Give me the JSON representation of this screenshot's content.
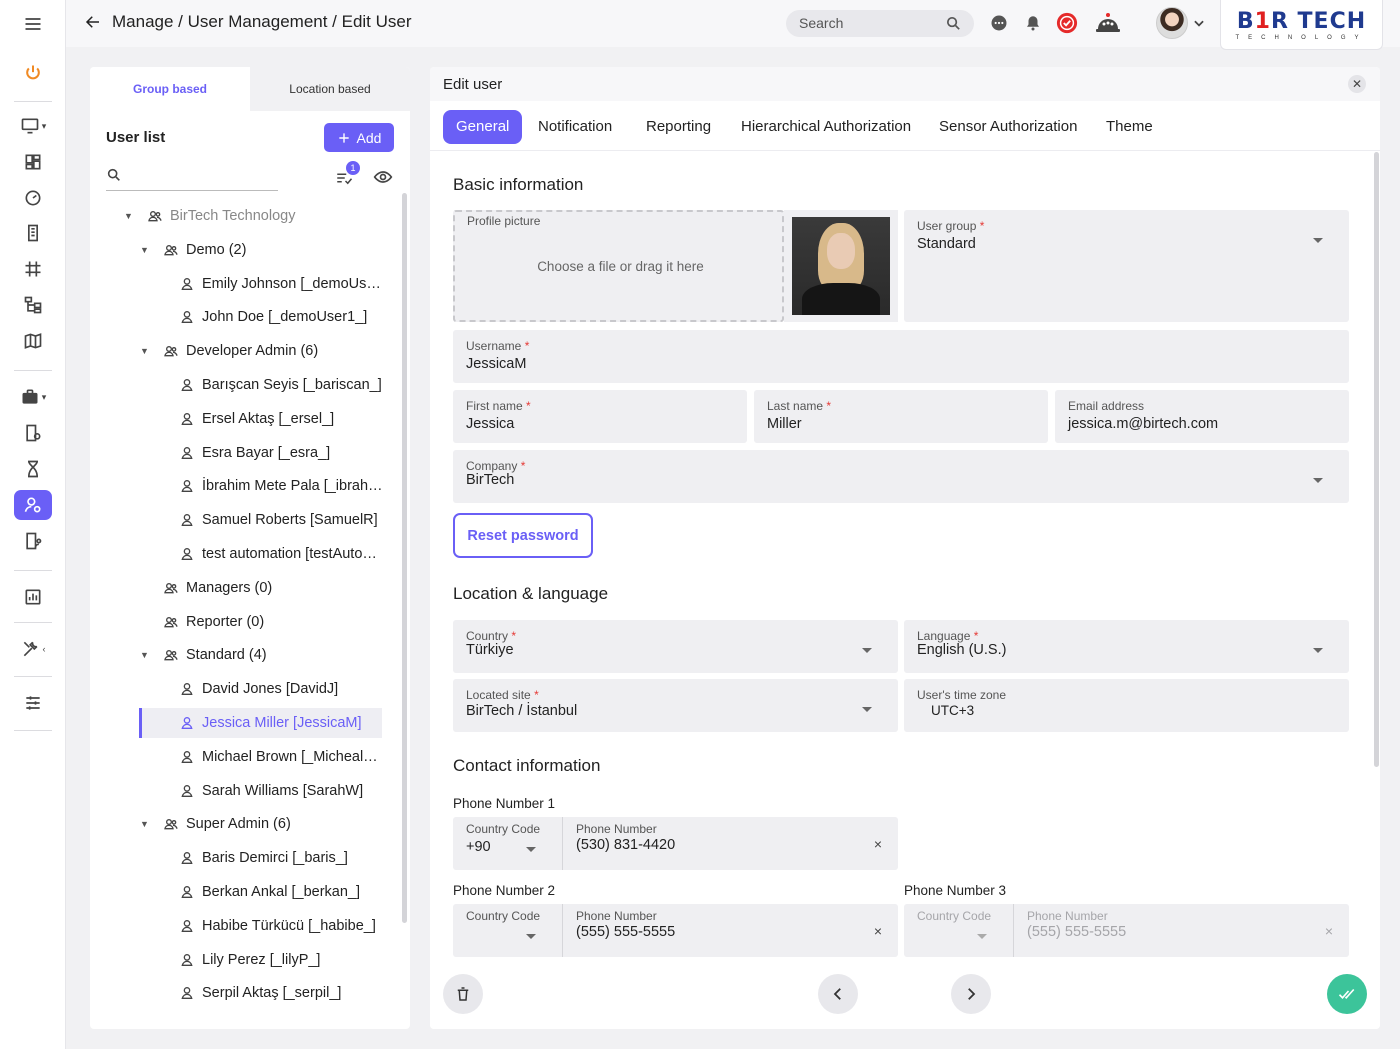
{
  "topbar": {
    "breadcrumb": "Manage / User Management / Edit User",
    "search_placeholder": "Search",
    "logo_main": "B1R TECH",
    "logo_sub": "TECHNOLOGY"
  },
  "left_panel": {
    "tabs": [
      {
        "label": "Group based",
        "active": true
      },
      {
        "label": "Location based",
        "active": false
      }
    ],
    "title": "User list",
    "add_label": "Add",
    "filter_badge": "1",
    "tree": [
      {
        "label": "BirTech Technology",
        "level": 0,
        "type": "root",
        "expanded": true
      },
      {
        "label": "Demo (2)",
        "level": 1,
        "type": "group",
        "expanded": true
      },
      {
        "label": "Emily Johnson [_demoUs…",
        "level": 2,
        "type": "user"
      },
      {
        "label": "John Doe [_demoUser1_]",
        "level": 2,
        "type": "user"
      },
      {
        "label": "Developer Admin (6)",
        "level": 1,
        "type": "group",
        "expanded": true
      },
      {
        "label": "Barışcan Seyis [_bariscan_]",
        "level": 2,
        "type": "user"
      },
      {
        "label": "Ersel Aktaş [_ersel_]",
        "level": 2,
        "type": "user"
      },
      {
        "label": "Esra Bayar [_esra_]",
        "level": 2,
        "type": "user"
      },
      {
        "label": "İbrahim Mete Pala [_ibrah…",
        "level": 2,
        "type": "user"
      },
      {
        "label": "Samuel Roberts [SamuelR]",
        "level": 2,
        "type": "user"
      },
      {
        "label": "test automation [testAuto…",
        "level": 2,
        "type": "user"
      },
      {
        "label": "Managers (0)",
        "level": 1,
        "type": "group",
        "expanded": false
      },
      {
        "label": "Reporter (0)",
        "level": 1,
        "type": "group",
        "expanded": false
      },
      {
        "label": "Standard (4)",
        "level": 1,
        "type": "group",
        "expanded": true
      },
      {
        "label": "David Jones [DavidJ]",
        "level": 2,
        "type": "user"
      },
      {
        "label": "Jessica Miller [JessicaM]",
        "level": 2,
        "type": "user",
        "selected": true
      },
      {
        "label": "Michael Brown [_Micheal…",
        "level": 2,
        "type": "user"
      },
      {
        "label": "Sarah Williams [SarahW]",
        "level": 2,
        "type": "user"
      },
      {
        "label": "Super Admin (6)",
        "level": 1,
        "type": "group",
        "expanded": true
      },
      {
        "label": "Baris Demirci [_baris_]",
        "level": 2,
        "type": "user"
      },
      {
        "label": "Berkan Ankal [_berkan_]",
        "level": 2,
        "type": "user"
      },
      {
        "label": "Habibe Türkücü [_habibe_]",
        "level": 2,
        "type": "user"
      },
      {
        "label": "Lily Perez [_lilyP_]",
        "level": 2,
        "type": "user"
      },
      {
        "label": "Serpil Aktaş [_serpil_]",
        "level": 2,
        "type": "user"
      }
    ]
  },
  "main": {
    "header": "Edit user",
    "tabs": [
      {
        "label": "General",
        "active": true
      },
      {
        "label": "Notification"
      },
      {
        "label": "Reporting"
      },
      {
        "label": "Hierarchical Authorization"
      },
      {
        "label": "Sensor Authorization"
      },
      {
        "label": "Theme"
      }
    ],
    "basic": {
      "title": "Basic information",
      "profile_label": "Profile picture",
      "profile_hint": "Choose a file or drag it here",
      "user_group_label": "User group",
      "user_group_value": "Standard",
      "username_label": "Username",
      "username_value": "JessicaM",
      "first_name_label": "First name",
      "first_name_value": "Jessica",
      "last_name_label": "Last name",
      "last_name_value": "Miller",
      "email_label": "Email address",
      "email_value": "jessica.m@birtech.com",
      "company_label": "Company",
      "company_value": "BirTech",
      "reset_label": "Reset password"
    },
    "location": {
      "title": "Location & language",
      "country_label": "Country",
      "country_value": "Türkiye",
      "language_label": "Language",
      "language_value": "English (U.S.)",
      "site_label": "Located site",
      "site_value": "BirTech / İstanbul",
      "tz_label": "User's time zone",
      "tz_value": "UTC+3"
    },
    "contact": {
      "title": "Contact information",
      "phones": [
        {
          "label": "Phone Number 1",
          "cc_label": "Country Code",
          "cc_value": "+90",
          "num_label": "Phone Number",
          "num_value": "(530) 831-4420",
          "disabled": false
        },
        {
          "label": "Phone Number 2",
          "cc_label": "Country Code",
          "cc_value": "",
          "num_label": "Phone Number",
          "num_value": "(555) 555-5555",
          "disabled": false
        },
        {
          "label": "Phone Number 3",
          "cc_label": "Country Code",
          "cc_value": "",
          "num_label": "Phone Number",
          "num_value": "(555) 555-5555",
          "disabled": true
        }
      ]
    },
    "required_mark": "*",
    "clear_mark": "×"
  },
  "colors": {
    "accent": "#6a5ff6",
    "success": "#3cc49a",
    "required": "#e53935"
  }
}
